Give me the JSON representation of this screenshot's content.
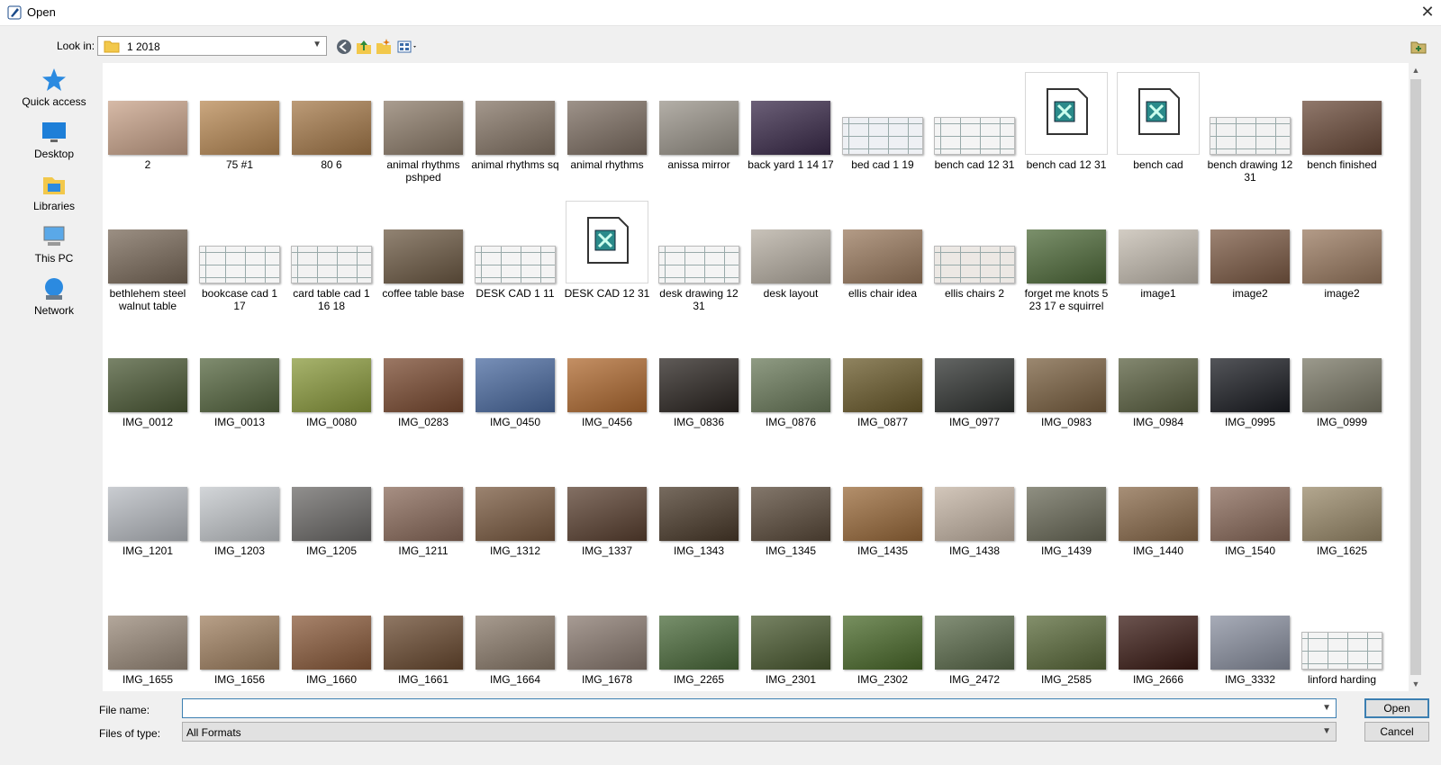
{
  "window": {
    "title": "Open",
    "close_glyph": "✕"
  },
  "toolbar": {
    "look_in_label": "Look in:",
    "look_in_value": "1 2018",
    "back_icon": "back-arrow-icon",
    "up_icon": "up-folder-icon",
    "new_folder_icon": "new-folder-icon",
    "view_menu_icon": "view-menu-icon"
  },
  "places": [
    {
      "label": "Quick access",
      "icon": "star-icon"
    },
    {
      "label": "Desktop",
      "icon": "desktop-icon"
    },
    {
      "label": "Libraries",
      "icon": "libraries-icon"
    },
    {
      "label": "This PC",
      "icon": "computer-icon"
    },
    {
      "label": "Network",
      "icon": "network-icon"
    }
  ],
  "files": [
    {
      "name": "2",
      "color": "#c9a38a",
      "kind": "photo"
    },
    {
      "name": "75 #1",
      "color": "#b98a55",
      "kind": "photo"
    },
    {
      "name": "80 6",
      "color": "#a67a4a",
      "kind": "photo"
    },
    {
      "name": "animal rhythms pshped",
      "color": "#8d7c6a",
      "kind": "photo"
    },
    {
      "name": "animal rhythms sq",
      "color": "#857566",
      "kind": "photo"
    },
    {
      "name": "animal rhythms",
      "color": "#7d6e62",
      "kind": "photo"
    },
    {
      "name": "anissa mirror",
      "color": "#9a948a",
      "kind": "photo"
    },
    {
      "name": "back yard 1 14 17",
      "color": "#3a2a4a",
      "kind": "photo"
    },
    {
      "name": "bed cad 1 19",
      "color": "#eef0f4",
      "kind": "drawing"
    },
    {
      "name": "bench cad 12 31",
      "color": "#f4f4f4",
      "kind": "drawing"
    },
    {
      "name": "bench cad 12 31",
      "color": "#ffffff",
      "kind": "file"
    },
    {
      "name": "bench cad",
      "color": "#ffffff",
      "kind": "file"
    },
    {
      "name": "bench drawing 12 31",
      "color": "#f2f2f2",
      "kind": "drawing"
    },
    {
      "name": "bench finished",
      "color": "#6b4b3a",
      "kind": "photo"
    },
    {
      "name": "bethlehem steel walnut table",
      "color": "#7a6a5a",
      "kind": "photo"
    },
    {
      "name": "bookcase cad 1 17",
      "color": "#f4f4f4",
      "kind": "drawing"
    },
    {
      "name": "card table cad 1 16 18",
      "color": "#f2f2f2",
      "kind": "drawing"
    },
    {
      "name": "coffee table base",
      "color": "#6d5a44",
      "kind": "photo"
    },
    {
      "name": "DESK CAD 1 11",
      "color": "#f4f4f4",
      "kind": "drawing"
    },
    {
      "name": "DESK CAD 12 31",
      "color": "#ffffff",
      "kind": "file"
    },
    {
      "name": "desk drawing 12 31",
      "color": "#f4f4f4",
      "kind": "drawing"
    },
    {
      "name": "desk layout",
      "color": "#b6aea2",
      "kind": "photo"
    },
    {
      "name": "ellis chair idea",
      "color": "#9a7a5e",
      "kind": "photo"
    },
    {
      "name": "ellis chairs 2",
      "color": "#ece8e4",
      "kind": "drawing"
    },
    {
      "name": "forget me knots 5 23 17 e squirrel",
      "color": "#4f6b3a",
      "kind": "photo"
    },
    {
      "name": "image1",
      "color": "#c4bcb0",
      "kind": "photo"
    },
    {
      "name": "image2",
      "color": "#7c5a44",
      "kind": "photo"
    },
    {
      "name": "image2",
      "color": "#9a7a60",
      "kind": "photo"
    },
    {
      "name": "IMG_0012",
      "color": "#4c5a36",
      "kind": "photo"
    },
    {
      "name": "IMG_0013",
      "color": "#55663f",
      "kind": "photo"
    },
    {
      "name": "IMG_0080",
      "color": "#8a9a3c",
      "kind": "photo"
    },
    {
      "name": "IMG_0283",
      "color": "#7a4a30",
      "kind": "photo"
    },
    {
      "name": "IMG_0450",
      "color": "#4a6aa0",
      "kind": "photo"
    },
    {
      "name": "IMG_0456",
      "color": "#b06a30",
      "kind": "photo"
    },
    {
      "name": "IMG_0836",
      "color": "#2a2420",
      "kind": "photo"
    },
    {
      "name": "IMG_0876",
      "color": "#6a7a5a",
      "kind": "photo"
    },
    {
      "name": "IMG_0877",
      "color": "#6a5a2a",
      "kind": "photo"
    },
    {
      "name": "IMG_0977",
      "color": "#2f3230",
      "kind": "photo"
    },
    {
      "name": "IMG_0983",
      "color": "#7a6040",
      "kind": "photo"
    },
    {
      "name": "IMG_0984",
      "color": "#5a6040",
      "kind": "photo"
    },
    {
      "name": "IMG_0995",
      "color": "#1a1c22",
      "kind": "photo"
    },
    {
      "name": "IMG_0999",
      "color": "#7a7866",
      "kind": "photo"
    },
    {
      "name": "IMG_1201",
      "color": "#b8bcc2",
      "kind": "photo"
    },
    {
      "name": "IMG_1203",
      "color": "#c4c8cc",
      "kind": "photo"
    },
    {
      "name": "IMG_1205",
      "color": "#6c6a68",
      "kind": "photo"
    },
    {
      "name": "IMG_1211",
      "color": "#8a6a5a",
      "kind": "photo"
    },
    {
      "name": "IMG_1312",
      "color": "#7a5a40",
      "kind": "photo"
    },
    {
      "name": "IMG_1337",
      "color": "#5a4030",
      "kind": "photo"
    },
    {
      "name": "IMG_1343",
      "color": "#4a3a2a",
      "kind": "photo"
    },
    {
      "name": "IMG_1345",
      "color": "#5a4a3a",
      "kind": "photo"
    },
    {
      "name": "IMG_1435",
      "color": "#9a6a3a",
      "kind": "photo"
    },
    {
      "name": "IMG_1438",
      "color": "#c4b4a4",
      "kind": "photo"
    },
    {
      "name": "IMG_1439",
      "color": "#6a6a58",
      "kind": "photo"
    },
    {
      "name": "IMG_1440",
      "color": "#8a6a4a",
      "kind": "photo"
    },
    {
      "name": "IMG_1540",
      "color": "#8a6a5a",
      "kind": "photo"
    },
    {
      "name": "IMG_1625",
      "color": "#9a8a6a",
      "kind": "photo"
    },
    {
      "name": "IMG_1655",
      "color": "#9a8a7a",
      "kind": "photo"
    },
    {
      "name": "IMG_1656",
      "color": "#a08060",
      "kind": "photo"
    },
    {
      "name": "IMG_1660",
      "color": "#8a5a3a",
      "kind": "photo"
    },
    {
      "name": "IMG_1661",
      "color": "#6a4a30",
      "kind": "photo"
    },
    {
      "name": "IMG_1664",
      "color": "#8a7a6a",
      "kind": "photo"
    },
    {
      "name": "IMG_1678",
      "color": "#8a7a70",
      "kind": "photo"
    },
    {
      "name": "IMG_2265",
      "color": "#4a6a3a",
      "kind": "photo"
    },
    {
      "name": "IMG_2301",
      "color": "#4a5a30",
      "kind": "photo"
    },
    {
      "name": "IMG_2302",
      "color": "#4a6a2a",
      "kind": "photo"
    },
    {
      "name": "IMG_2472",
      "color": "#5a6a4a",
      "kind": "photo"
    },
    {
      "name": "IMG_2585",
      "color": "#5a6a3a",
      "kind": "photo"
    },
    {
      "name": "IMG_2666",
      "color": "#3a1a14",
      "kind": "photo"
    },
    {
      "name": "IMG_3332",
      "color": "#8a90a0",
      "kind": "photo"
    },
    {
      "name": "linford harding",
      "color": "#f4f4f4",
      "kind": "drawing"
    }
  ],
  "footer": {
    "file_name_label": "File name:",
    "file_name_value": "",
    "files_of_type_label": "Files of type:",
    "files_of_type_value": "All Formats",
    "open_label": "Open",
    "cancel_label": "Cancel"
  }
}
